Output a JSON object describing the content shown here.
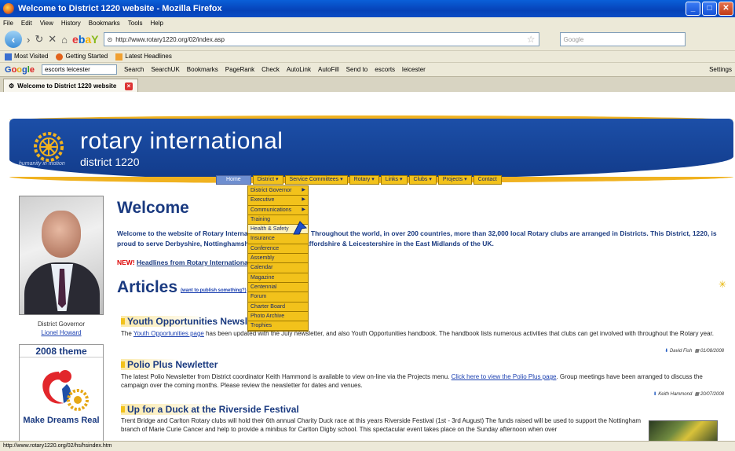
{
  "window": {
    "title": "Welcome to District 1220 website - Mozilla Firefox"
  },
  "menu": [
    "File",
    "Edit",
    "View",
    "History",
    "Bookmarks",
    "Tools",
    "Help"
  ],
  "nav": {
    "url": "http://www.rotary1220.org/02/index.asp",
    "search_placeholder": "Google",
    "ebay": {
      "e": "e",
      "b": "b",
      "a": "a",
      "y": "Y"
    }
  },
  "bookmarks": [
    "Most Visited",
    "Getting Started",
    "Latest Headlines"
  ],
  "gtoolbar": {
    "logo": {
      "g1": "G",
      "g2": "o",
      "g3": "o",
      "g4": "g",
      "g5": "l",
      "g6": "e"
    },
    "query": "escorts leicester",
    "items": [
      "Search",
      "SearchUK",
      "Bookmarks",
      "PageRank",
      "Check",
      "AutoLink",
      "AutoFill",
      "Send to",
      "escorts",
      "leicester"
    ],
    "settings": "Settings"
  },
  "tab": {
    "label": "Welcome to District 1220 website"
  },
  "banner": {
    "brand": "rotary international",
    "district": "district 1220",
    "motto": "humanity in motion"
  },
  "sitenav": [
    "Home",
    "District ▾",
    "Service Committees ▾",
    "Rotary ▾",
    "Links ▾",
    "Clubs ▾",
    "Projects ▾",
    "Contact"
  ],
  "dropdown": [
    "District Governor",
    "Executive",
    "Communications",
    "Training",
    "Health & Safety",
    "Insurance",
    "Conference",
    "Assembly",
    "Calendar",
    "Magazine",
    "Centennial",
    "Forum",
    "Charter Board",
    "Photo Archive",
    "Trophies"
  ],
  "sidebar": {
    "gov_label": "District Governor",
    "gov_name": "Lionel Howard",
    "theme_title": "2008 theme",
    "theme_caption": "Make Dreams Real"
  },
  "main": {
    "welcome": "Welcome",
    "intro": "Welcome to the website of Rotary International District 1220. Throughout the world, in over 200 countries, more than 32,000 local Rotary clubs are arranged in Districts. This District, 1220, is proud to serve Derbyshire, Nottinghamshire and parts of Staffordshire & Leicestershire in the East Midlands of the UK.",
    "new_tag": "NEW!",
    "news_link": "Headlines from Rotary International - see below.",
    "articles": "Articles",
    "want_link": "(want to publish something?)"
  },
  "articles": [
    {
      "title": "Youth Opportunities Newsletter",
      "pre": "The ",
      "link": "Youth Opportunities page",
      "post": " has been updated with the July newsletter, and also Youth Opportunities handbook. The handbook lists numerous activities that clubs can get involved with throughout the Rotary year.",
      "author": "David Fish",
      "date": "01/08/2008"
    },
    {
      "title": "Polio Plus Newletter",
      "pre": "The latest Polio Newsletter from District coordinator Keith Hammond is available to view on-line via the Projects menu. ",
      "link": "Click here to view the Polio Plus page",
      "post": ". Group meetings have been arranged to discuss the campaign over the coming months. Please review the newsletter for dates and venues.",
      "author": "Keith Hammond",
      "date": "20/07/2008"
    },
    {
      "title": "Up for a Duck at the Riverside Festival",
      "pre": "",
      "link": "",
      "post": "Trent Bridge and Carlton Rotary clubs will hold their 6th annual Charity Duck race at this years Riverside Festival (1st - 3rd August) The funds raised will be used to support the Nottingham branch of Marie Curie Cancer and help to provide a minibus for Carlton Digby school. This spectacular event takes place on the Sunday afternoon when over",
      "author": "",
      "date": ""
    }
  ],
  "status": "http://www.rotary1220.org/02/hs/hsindex.htm"
}
